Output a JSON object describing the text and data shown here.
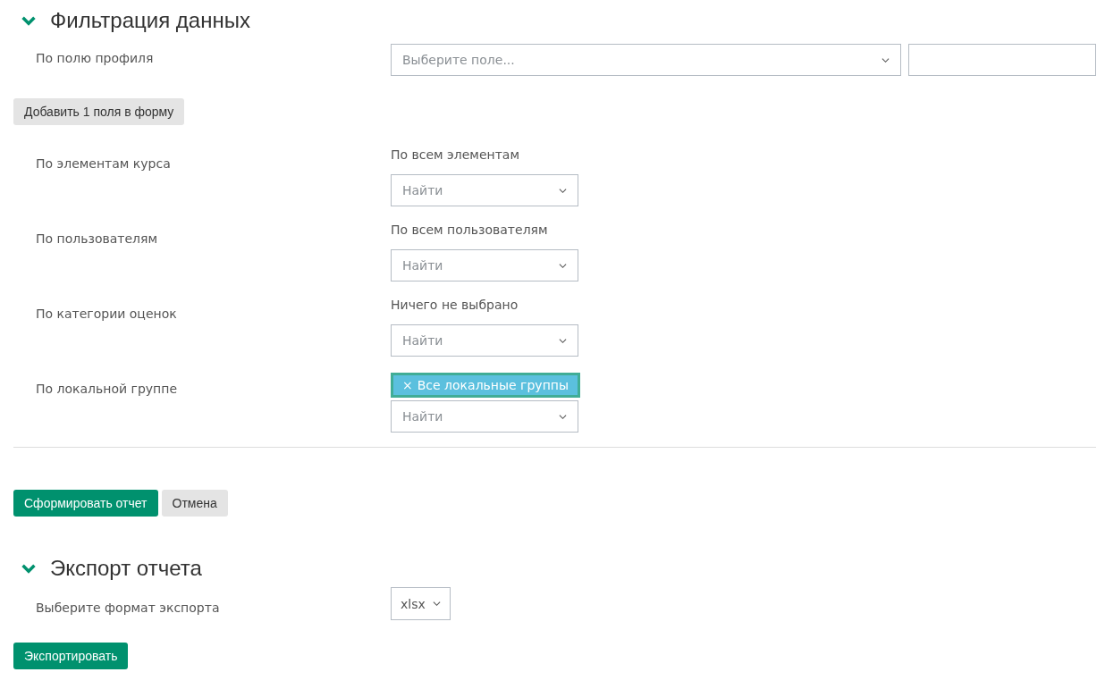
{
  "filter_section": {
    "title": "Фильтрация данных",
    "expanded": true,
    "profile_field": {
      "label": "По полю профиля",
      "select_placeholder": "Выберите поле..."
    },
    "add_button": "Добавить 1 поля в форму",
    "filters": [
      {
        "label": "По элементам курса",
        "kind": "summary",
        "summary": "По всем элементам",
        "search_placeholder": "Найти"
      },
      {
        "label": "По пользователям",
        "kind": "summary",
        "summary": "По всем пользователям",
        "search_placeholder": "Найти"
      },
      {
        "label": "По категории оценок",
        "kind": "summary",
        "summary": "Ничего не выбрано",
        "search_placeholder": "Найти"
      },
      {
        "label": "По локальной группе",
        "kind": "tags",
        "tags": [
          {
            "remove": "×",
            "label": "Все локальные группы"
          }
        ],
        "search_placeholder": "Найти"
      }
    ]
  },
  "actions": {
    "submit": "Сформировать отчет",
    "cancel": "Отмена"
  },
  "export_section": {
    "title": "Экспорт отчета",
    "expanded": true,
    "format_label": "Выберите формат экспорта",
    "format_value": "xlsx",
    "button": "Экспортировать"
  }
}
